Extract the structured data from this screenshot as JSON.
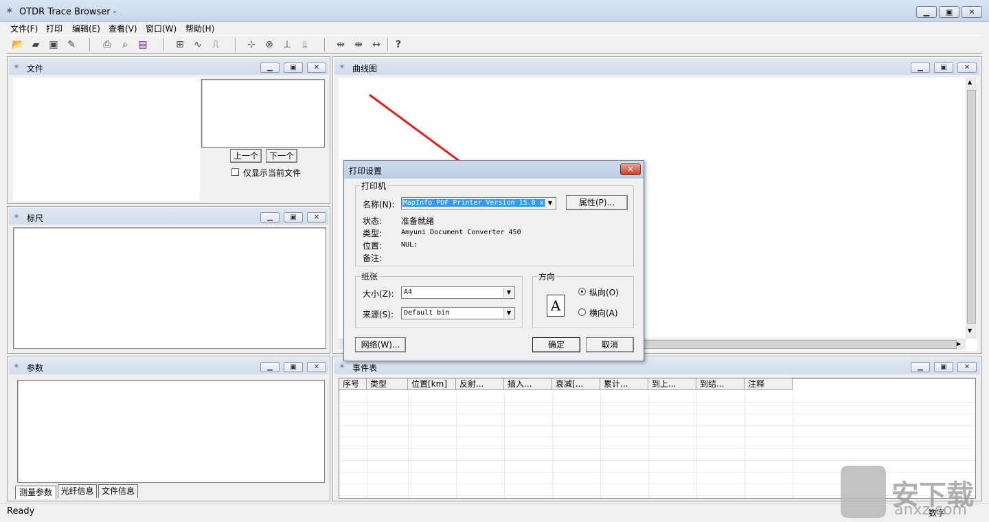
{
  "app": {
    "title": "OTDR Trace Browser -"
  },
  "menu": [
    "文件(F)",
    "打印",
    "编辑(E)",
    "查看(V)",
    "窗口(W)",
    "帮助(H)"
  ],
  "panels": {
    "file": {
      "title": "文件",
      "prev": "上一个",
      "next": "下一个",
      "only_current": "仅显示当前文件"
    },
    "ruler": {
      "title": "标尺"
    },
    "params": {
      "title": "参数",
      "tabs": [
        "测量参数",
        "光纤信息",
        "文件信息"
      ]
    },
    "curve": {
      "title": "曲线图"
    },
    "events": {
      "title": "事件表",
      "columns": [
        "序号",
        "类型",
        "位置[km]",
        "反射...",
        "插入...",
        "衰减[...",
        "累计...",
        "到上...",
        "到结...",
        "注释"
      ]
    }
  },
  "dialog": {
    "title": "打印设置",
    "printer_group": "打印机",
    "name_label": "名称(N):",
    "name_value": "MapInfo PDF Printer Version 15.0 x",
    "properties_btn": "属性(P)...",
    "status_label": "状态:",
    "status_value": "准备就绪",
    "type_label": "类型:",
    "type_value": "Amyuni Document Converter 450",
    "where_label": "位置:",
    "where_value": "NUL:",
    "comment_label": "备注:",
    "paper_group": "纸张",
    "size_label": "大小(Z):",
    "size_value": "A4",
    "source_label": "来源(S):",
    "source_value": "Default bin",
    "orient_group": "方向",
    "portrait": "纵向(O)",
    "landscape": "横向(A)",
    "network_btn": "网络(W)...",
    "ok_btn": "确定",
    "cancel_btn": "取消",
    "orientation_selected": "portrait"
  },
  "status": {
    "left": "Ready",
    "right": "数字"
  },
  "watermark": {
    "text": "安下载",
    "sub": "anxz.com"
  },
  "colors": {
    "arrow": "#e0201a",
    "select_bg": "#3399ff"
  }
}
